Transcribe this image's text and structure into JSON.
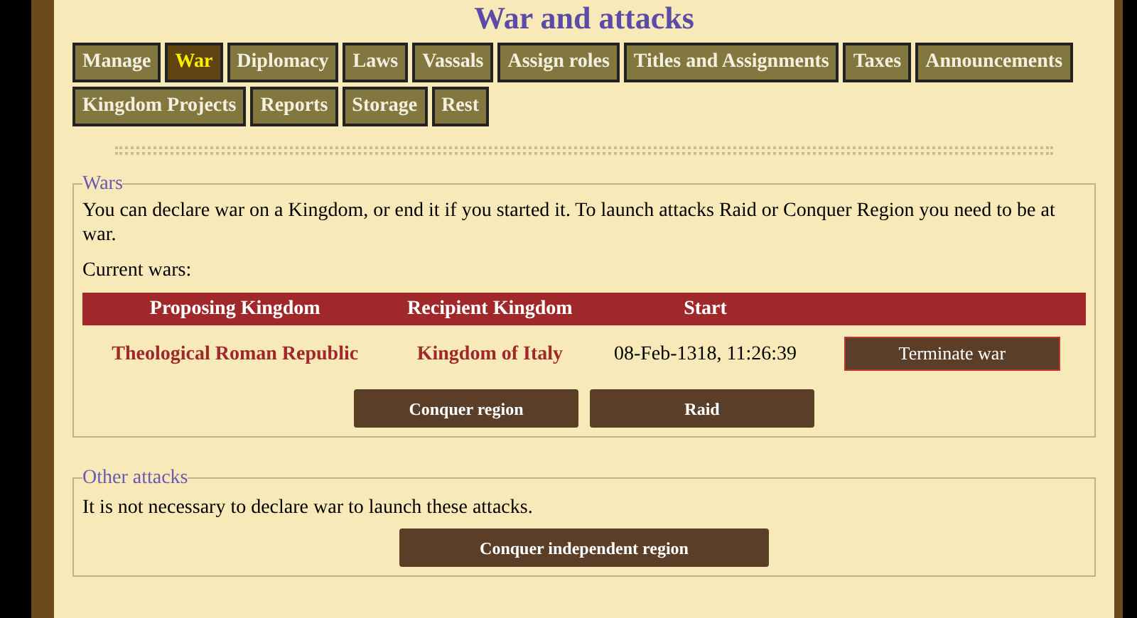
{
  "title": "War and attacks",
  "tabs": [
    {
      "label": "Manage",
      "selected": false
    },
    {
      "label": "War",
      "selected": true
    },
    {
      "label": "Diplomacy",
      "selected": false
    },
    {
      "label": "Laws",
      "selected": false
    },
    {
      "label": "Vassals",
      "selected": false
    },
    {
      "label": "Assign roles",
      "selected": false
    },
    {
      "label": "Titles and Assignments",
      "selected": false
    },
    {
      "label": "Taxes",
      "selected": false
    },
    {
      "label": "Announcements",
      "selected": false
    },
    {
      "label": "Kingdom Projects",
      "selected": false
    },
    {
      "label": "Reports",
      "selected": false
    },
    {
      "label": "Storage",
      "selected": false
    },
    {
      "label": "Rest",
      "selected": false
    }
  ],
  "wars": {
    "legend": "Wars",
    "intro": "You can declare war on a Kingdom, or end it if you started it. To launch attacks Raid or Conquer Region you need to be at war.",
    "current_label": "Current wars:",
    "table": {
      "columns": [
        "Proposing Kingdom",
        "Recipient Kingdom",
        "Start"
      ],
      "rows": [
        {
          "proposing": "Theological Roman Republic",
          "recipient": "Kingdom of Italy",
          "start": "08-Feb-1318, 11:26:39",
          "action": "Terminate war"
        }
      ]
    },
    "buttons": [
      "Conquer region",
      "Raid"
    ]
  },
  "other_attacks": {
    "legend": "Other attacks",
    "text": "It is not necessary to declare war to launch these attacks.",
    "buttons": [
      "Conquer independent region"
    ]
  }
}
